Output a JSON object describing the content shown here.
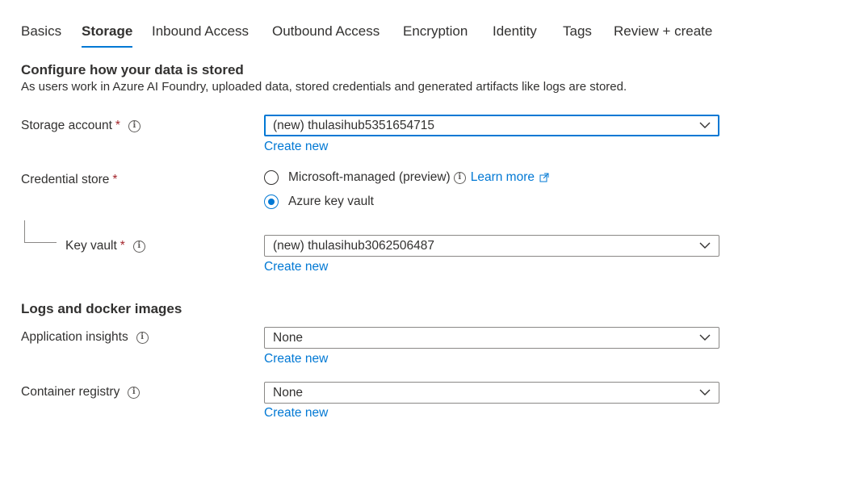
{
  "tabs": [
    {
      "label": "Basics",
      "active": false
    },
    {
      "label": "Storage",
      "active": true
    },
    {
      "label": "Inbound Access",
      "active": false
    },
    {
      "label": "Outbound Access",
      "active": false
    },
    {
      "label": "Encryption",
      "active": false
    },
    {
      "label": "Identity",
      "active": false
    },
    {
      "label": "Tags",
      "active": false
    },
    {
      "label": "Review + create",
      "active": false
    }
  ],
  "storage_section": {
    "title": "Configure how your data is stored",
    "description": "As users work in Azure AI Foundry, uploaded data, stored credentials and generated artifacts like logs are stored."
  },
  "storage_account": {
    "label": "Storage account",
    "required_mark": "*",
    "info_icon": "i",
    "value": "(new) thulasihub5351654715",
    "create_new": "Create new"
  },
  "credential_store": {
    "label": "Credential store",
    "required_mark": "*",
    "options": [
      {
        "label": "Microsoft-managed (preview)",
        "checked": false
      },
      {
        "label": "Azure key vault",
        "checked": true
      }
    ],
    "info_icon": "i",
    "learn_more": "Learn more"
  },
  "key_vault": {
    "label": "Key vault",
    "required_mark": "*",
    "info_icon": "i",
    "value": "(new) thulasihub3062506487",
    "create_new": "Create new"
  },
  "logs_section": {
    "title": "Logs and docker images"
  },
  "application_insights": {
    "label": "Application insights",
    "info_icon": "i",
    "value": "None",
    "create_new": "Create new"
  },
  "container_registry": {
    "label": "Container registry",
    "info_icon": "i",
    "value": "None",
    "create_new": "Create new"
  },
  "colors": {
    "accent": "#0078d4",
    "required": "#a4262c",
    "text": "#323130",
    "border": "#8a8886"
  }
}
